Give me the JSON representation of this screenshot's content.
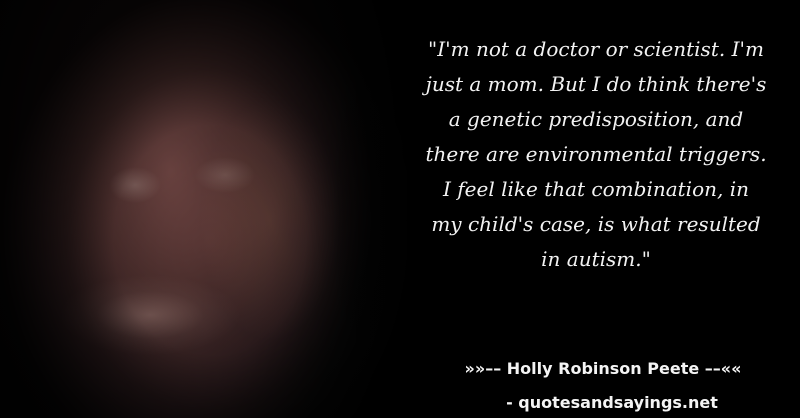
{
  "quote": {
    "text": "\"I'm not a doctor or scientist. I'm\njust a mom. But I do think there's\na genetic predisposition, and\nthere are environmental triggers.\nI feel like that combination, in\nmy child's case, is what resulted\nin autism.\""
  },
  "attribution": {
    "text": "»»–– Holly Robinson Peete ––««"
  },
  "source": {
    "text": "- quotesandsayings.net"
  },
  "image": {
    "subject": "portrait-photo"
  },
  "colors": {
    "background": "#000000",
    "text": "#f2f2f2"
  }
}
